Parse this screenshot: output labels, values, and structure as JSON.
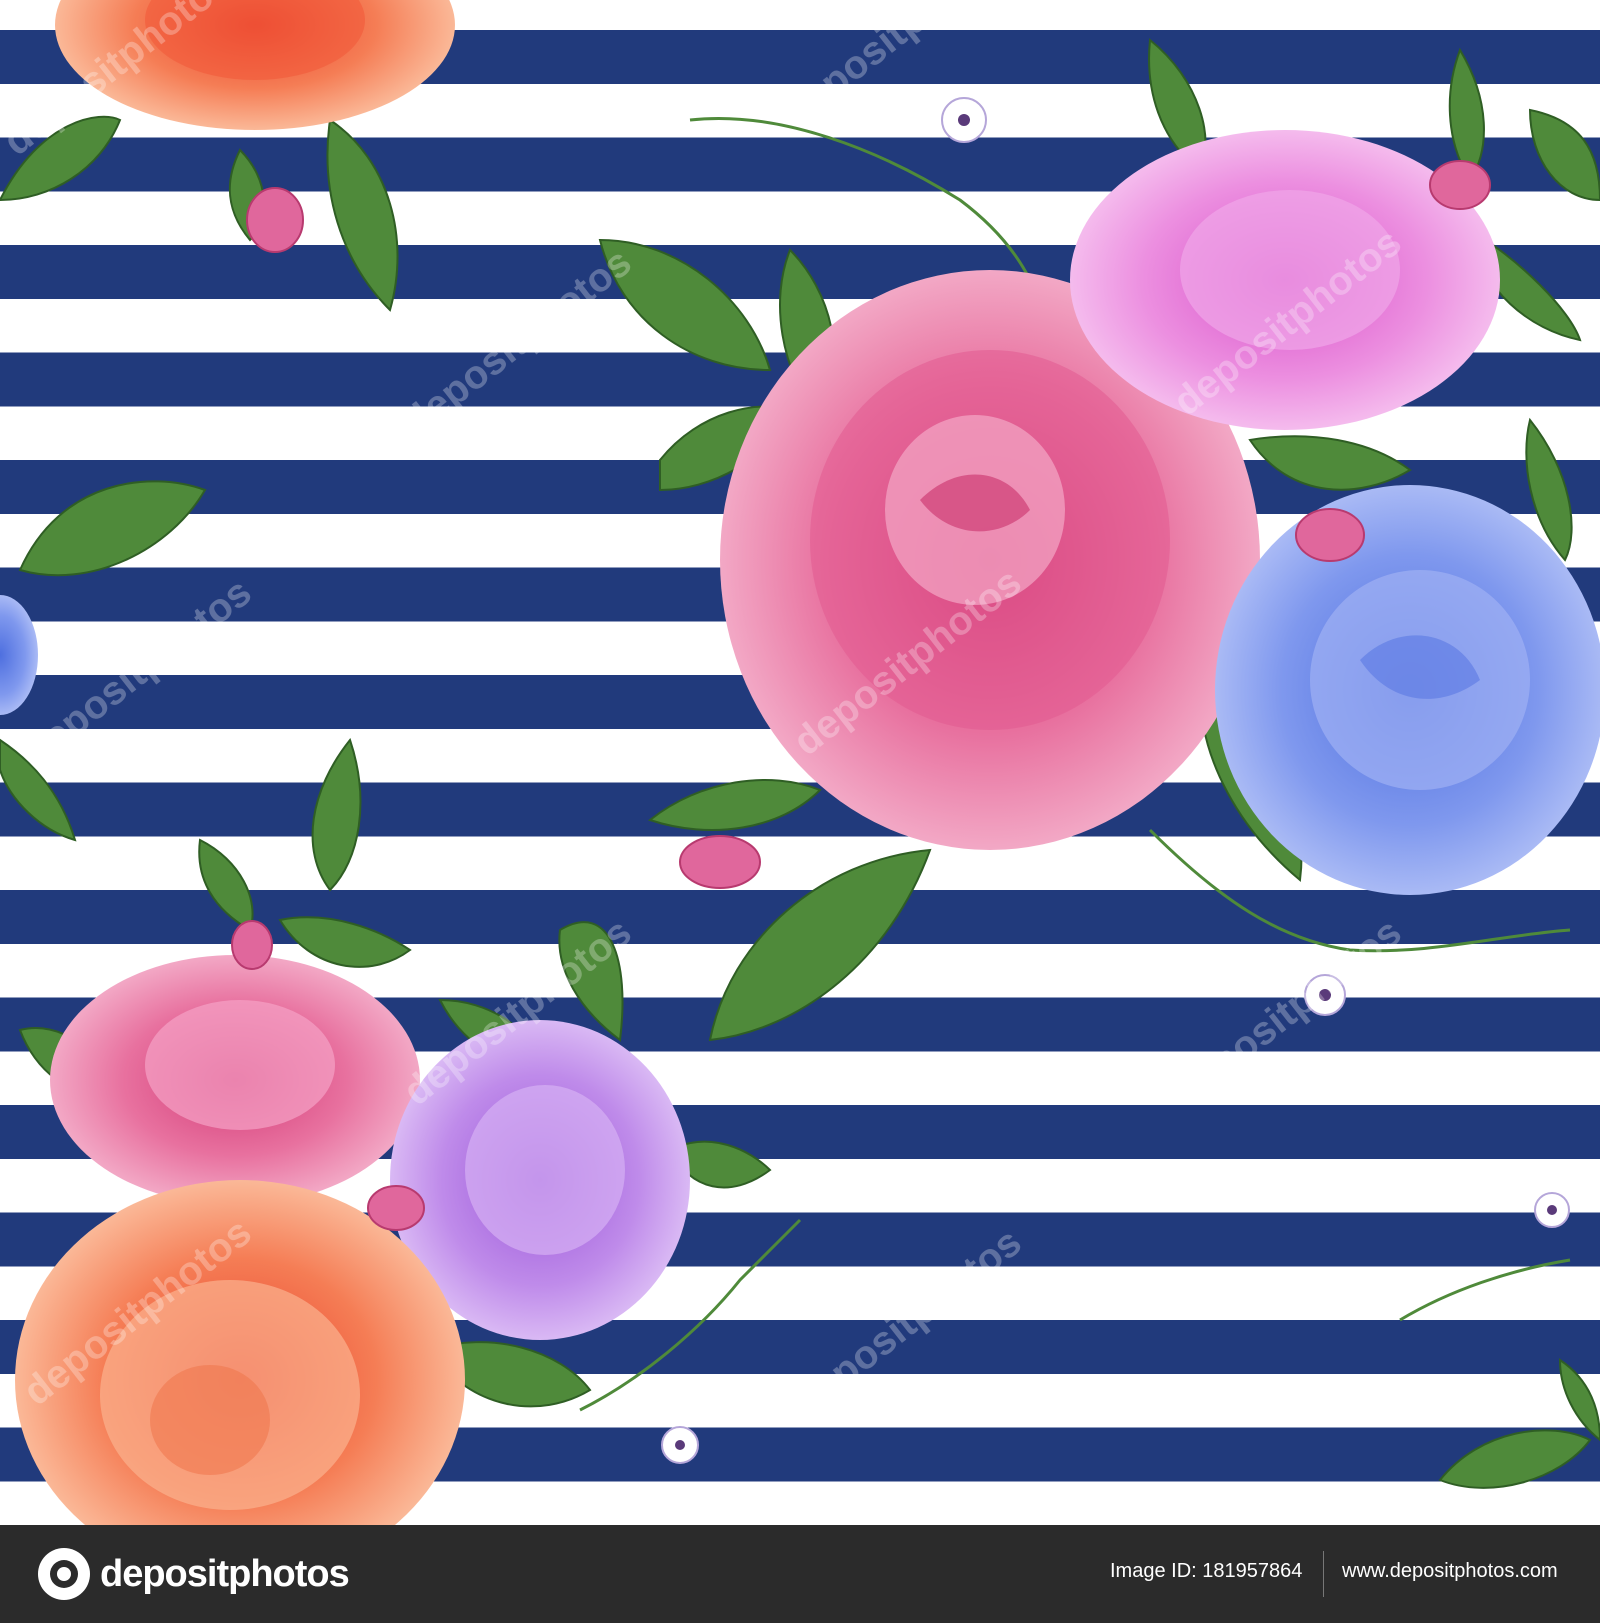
{
  "colors": {
    "stripe_navy": "#213a7c",
    "stripe_white": "#ffffff",
    "leaf_green": "#4f8a3a",
    "footer_bg": "#2b2b2b"
  },
  "watermark_text": "depositphotos",
  "footer": {
    "logo_text": "depositphotos",
    "image_id": "Image ID: 181957864",
    "site_url": "www.depositphotos.com"
  }
}
